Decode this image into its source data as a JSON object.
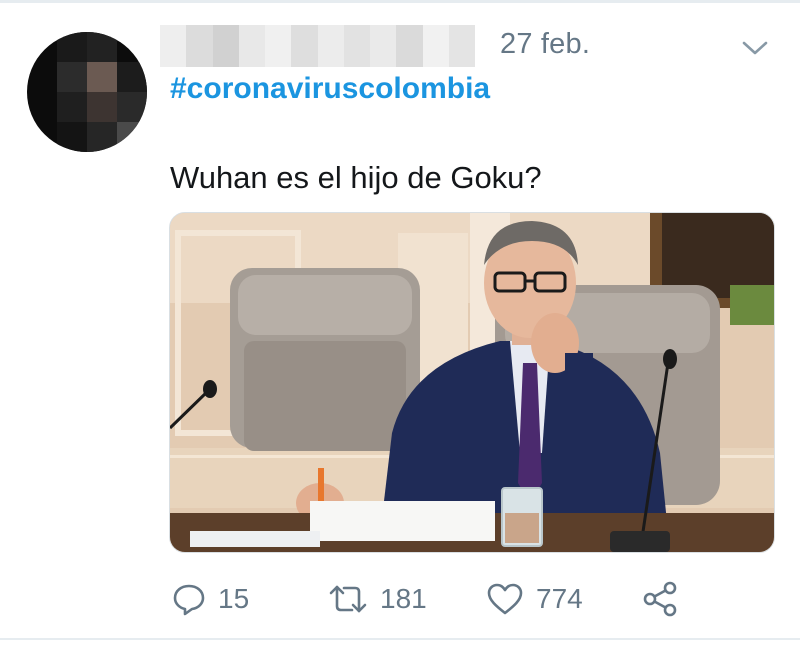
{
  "tweet": {
    "date": "27 feb.",
    "hashtag": "#coronaviruscolombia",
    "text": "Wuhan es el hijo de Goku?",
    "media_alt": "Photo of a man in a dark suit and purple tie seated at a conference table with a microphone and glass of water"
  },
  "actions": {
    "reply": {
      "icon": "reply-icon",
      "count": "15"
    },
    "retweet": {
      "icon": "retweet-icon",
      "count": "181"
    },
    "like": {
      "icon": "heart-icon",
      "count": "774"
    },
    "share": {
      "icon": "share-icon"
    }
  },
  "colors": {
    "hashtag": "#1b95e0",
    "secondary_text": "#657786",
    "primary_text": "#14171a",
    "divider": "#e6ecf0"
  }
}
